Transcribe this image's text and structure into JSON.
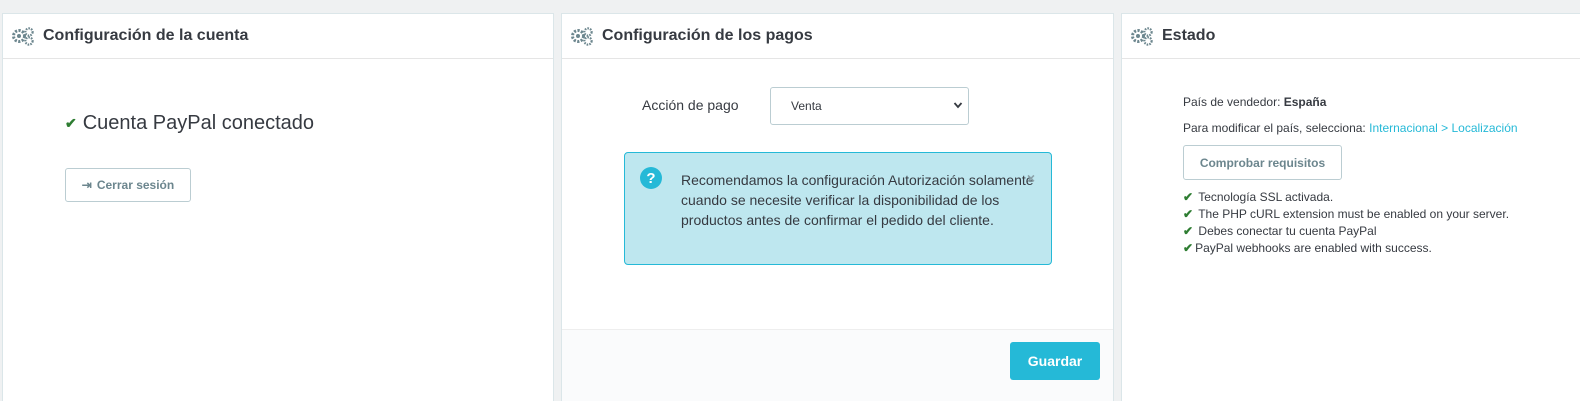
{
  "panels": {
    "account": {
      "title": "Configuración de la cuenta",
      "status": "Cuenta PayPal conectado",
      "logout_label": "Cerrar sesión"
    },
    "payments": {
      "title": "Configuración de los pagos",
      "action_label": "Acción de pago",
      "action_value": "Venta",
      "alert_text": "Recomendamos la configuración Autorización solamente cuando se necesite verificar la disponibilidad de los productos antes de confirmar el pedido del cliente.",
      "alert_close": "×",
      "save_label": "Guardar"
    },
    "status": {
      "title": "Estado",
      "country_label": "País de vendedor:",
      "country_value": "España",
      "modify_text": "Para modificar el país, selecciona:",
      "modify_link": "Internacional > Localización",
      "check_button": "Comprobar requisitos",
      "checks": [
        "Tecnología SSL activada.",
        "The PHP cURL extension must be enabled on your server.",
        "Debes conectar tu cuenta PayPal",
        "PayPal webhooks are enabled with success."
      ]
    }
  },
  "colors": {
    "accent": "#25b9d7",
    "alert_bg": "#bee7ef",
    "success": "#2e7d32"
  },
  "icons": {
    "panel_heading": "gears-icon",
    "check": "check-icon",
    "logout": "sign-out-icon",
    "alert": "question-circle-icon",
    "close": "close-icon",
    "select": "chevron-down-icon"
  }
}
